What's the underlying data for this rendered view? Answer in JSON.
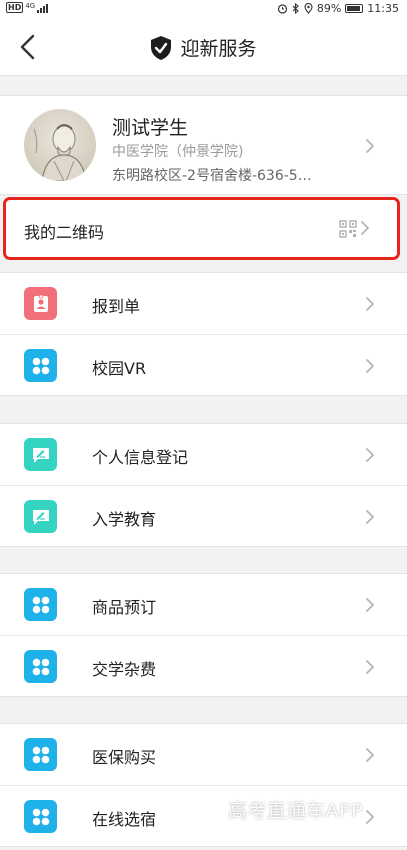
{
  "status_bar": {
    "hd": "HD",
    "network": "4G",
    "battery": "89%",
    "time": "11:35"
  },
  "nav": {
    "title": "迎新服务"
  },
  "profile": {
    "name": "测试学生",
    "college": "中医学院（仲景学院)",
    "address": "东明路校区-2号宿舍楼-636-5…"
  },
  "qr_row": {
    "label": "我的二维码"
  },
  "groups": [
    {
      "items": [
        {
          "label": "报到单",
          "icon": "id-badge-icon",
          "color": "#f06f78"
        },
        {
          "label": "校园VR",
          "icon": "grid-flower-icon",
          "color": "#1fb1ea"
        }
      ]
    },
    {
      "items": [
        {
          "label": "个人信息登记",
          "icon": "edit-message-icon",
          "color": "#35d3c2"
        },
        {
          "label": "入学教育",
          "icon": "edit-message-icon",
          "color": "#35d3c2"
        }
      ]
    },
    {
      "items": [
        {
          "label": "商品预订",
          "icon": "grid-flower-icon",
          "color": "#1fb1ea"
        },
        {
          "label": "交学杂费",
          "icon": "grid-flower-icon",
          "color": "#1fb1ea"
        }
      ]
    },
    {
      "items": [
        {
          "label": "医保购买",
          "icon": "grid-flower-icon",
          "color": "#1fb1ea"
        },
        {
          "label": "在线选宿",
          "icon": "grid-flower-icon",
          "color": "#1fb1ea"
        }
      ]
    }
  ],
  "watermark": "高考直通车APP"
}
